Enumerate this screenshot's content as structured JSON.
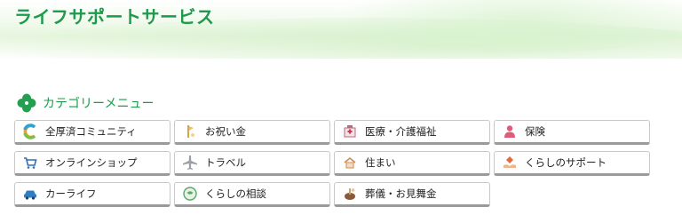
{
  "header": {
    "title": "ライフサポートサービス"
  },
  "categories": {
    "heading": "カテゴリーメニュー",
    "items": [
      {
        "label": "全厚済コミュニティ",
        "icon": "community-c-icon"
      },
      {
        "label": "お祝い金",
        "icon": "celebration-icon"
      },
      {
        "label": "医療・介護福祉",
        "icon": "hospital-icon"
      },
      {
        "label": "保険",
        "icon": "insurance-person-icon"
      },
      {
        "label": "オンラインショップ",
        "icon": "shopping-cart-icon"
      },
      {
        "label": "トラベル",
        "icon": "airplane-icon"
      },
      {
        "label": "住まい",
        "icon": "house-icon"
      },
      {
        "label": "くらしのサポート",
        "icon": "support-hands-icon"
      },
      {
        "label": "カーライフ",
        "icon": "car-icon"
      },
      {
        "label": "くらしの相談",
        "icon": "consultation-icon"
      },
      {
        "label": "葬儀・お見舞金",
        "icon": "ceremony-icon"
      }
    ]
  },
  "colors": {
    "accent": "#1d9a4a",
    "button_border": "#c9c9c9",
    "button_shadow": "#9a9a9a"
  }
}
